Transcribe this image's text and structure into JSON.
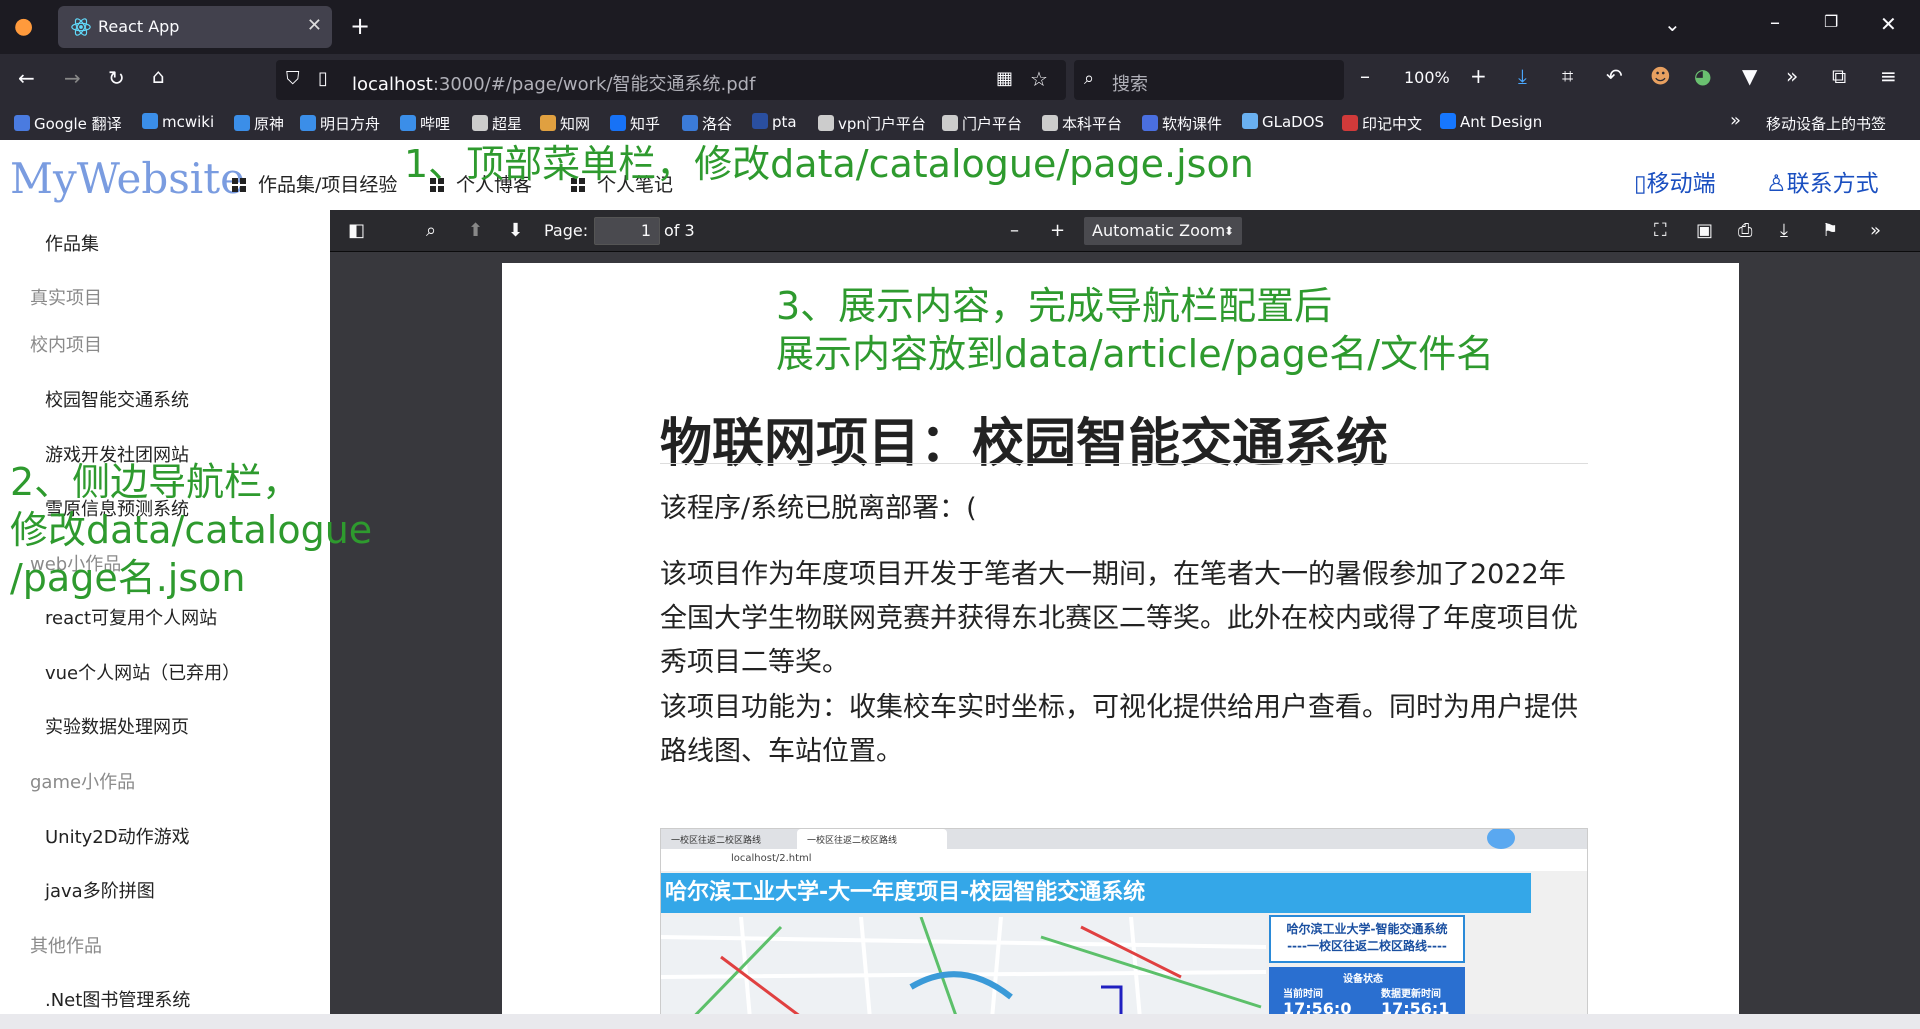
{
  "browser": {
    "tab_title": "React App",
    "url_host": "localhost",
    "url_rest": ":3000/#/page/work/智能交通系统.pdf",
    "search_placeholder": "搜索",
    "zoom": "100%"
  },
  "bookmarks": [
    {
      "label": "Google 翻译",
      "color": "#4a7be0"
    },
    {
      "label": "mcwiki",
      "color": "#3b8ee8"
    },
    {
      "label": "原神",
      "color": "#3b8ee8"
    },
    {
      "label": "明日方舟",
      "color": "#3b8ee8"
    },
    {
      "label": "哔哩",
      "color": "#3b8ee8"
    },
    {
      "label": "超星",
      "color": "#cccccc"
    },
    {
      "label": "知网",
      "color": "#e0a040"
    },
    {
      "label": "知乎",
      "color": "#1772f6"
    },
    {
      "label": "洛谷",
      "color": "#3b7bd8"
    },
    {
      "label": "pta",
      "color": "#2a4fa0"
    },
    {
      "label": "vpn门户平台",
      "color": "#cccccc"
    },
    {
      "label": "门户平台",
      "color": "#cccccc"
    },
    {
      "label": "本科平台",
      "color": "#cccccc"
    },
    {
      "label": "软构课件",
      "color": "#4a6fe0"
    },
    {
      "label": "GLaDOS",
      "color": "#6ab0f0"
    },
    {
      "label": "印记中文",
      "color": "#d03a3a"
    },
    {
      "label": "Ant Design",
      "color": "#1677ff"
    }
  ],
  "mobile_bookmarks": "移动设备上的书签",
  "site": {
    "logo": "MyWebsite",
    "menu": [
      "作品集/项目经验",
      "个人博客",
      "个人笔记"
    ],
    "mobile": "移动端",
    "contact": "联系方式"
  },
  "sidebar": {
    "entries": [
      {
        "type": "item",
        "label": "作品集"
      },
      {
        "type": "group",
        "label": "真实项目"
      },
      {
        "type": "group",
        "label": "校内项目"
      },
      {
        "type": "item",
        "label": "校园智能交通系统"
      },
      {
        "type": "item",
        "label": "游戏开发社团网站"
      },
      {
        "type": "item",
        "label": "雪原信息预测系统"
      },
      {
        "type": "group",
        "label": "web小作品"
      },
      {
        "type": "item",
        "label": "react可复用个人网站"
      },
      {
        "type": "item",
        "label": "vue个人网站（已弃用）"
      },
      {
        "type": "item",
        "label": "实验数据处理网页"
      },
      {
        "type": "group",
        "label": "game小作品"
      },
      {
        "type": "item",
        "label": "Unity2D动作游戏"
      },
      {
        "type": "item",
        "label": "java多阶拼图"
      },
      {
        "type": "group",
        "label": "其他作品"
      },
      {
        "type": "item",
        "label": ".Net图书管理系统"
      }
    ]
  },
  "pdf": {
    "page_label": "Page:",
    "page_value": "1",
    "of_pages": "of 3",
    "zoom_value": "Automatic Zoom",
    "doc_title": "物联网项目：校园智能交通系统",
    "paragraphs": [
      "该程序/系统已脱离部署：(",
      "该项目作为年度项目开发于笔者大一期间，在笔者大一的暑假参加了2022年全国大学生物联网竞赛并获得东北赛区二等奖。此外在校内或得了年度项目优秀项目二等奖。",
      "该项目功能为：收集校车实时坐标，可视化提供给用户查看。同时为用户提供路线图、车站位置。"
    ],
    "embedded": {
      "tab1": "一校区往返二校区路线",
      "tab2": "一校区往返二校区路线",
      "address": "localhost/2.html",
      "banner": "哈尔滨工业大学-大一年度项目-校园智能交通系统",
      "panel_line1": "哈尔滨工业大学-智能交通系统",
      "panel_line2": "----一校区往返二校区路线----",
      "status_title": "设备状态",
      "col1": "当前时间",
      "col2": "数据更新时间",
      "val1": "17:56:0",
      "val2": "17:56:1"
    }
  },
  "annotations": {
    "top": "1、顶部菜单栏，修改data/catalogue/page.json",
    "side_line1": "2、侧边导航栏，",
    "side_line2": "修改data/catalogue",
    "side_line3": "/page名.json",
    "content_line1": "3、展示内容，完成导航栏配置后",
    "content_line2": "展示内容放到data/article/page名/文件名"
  }
}
